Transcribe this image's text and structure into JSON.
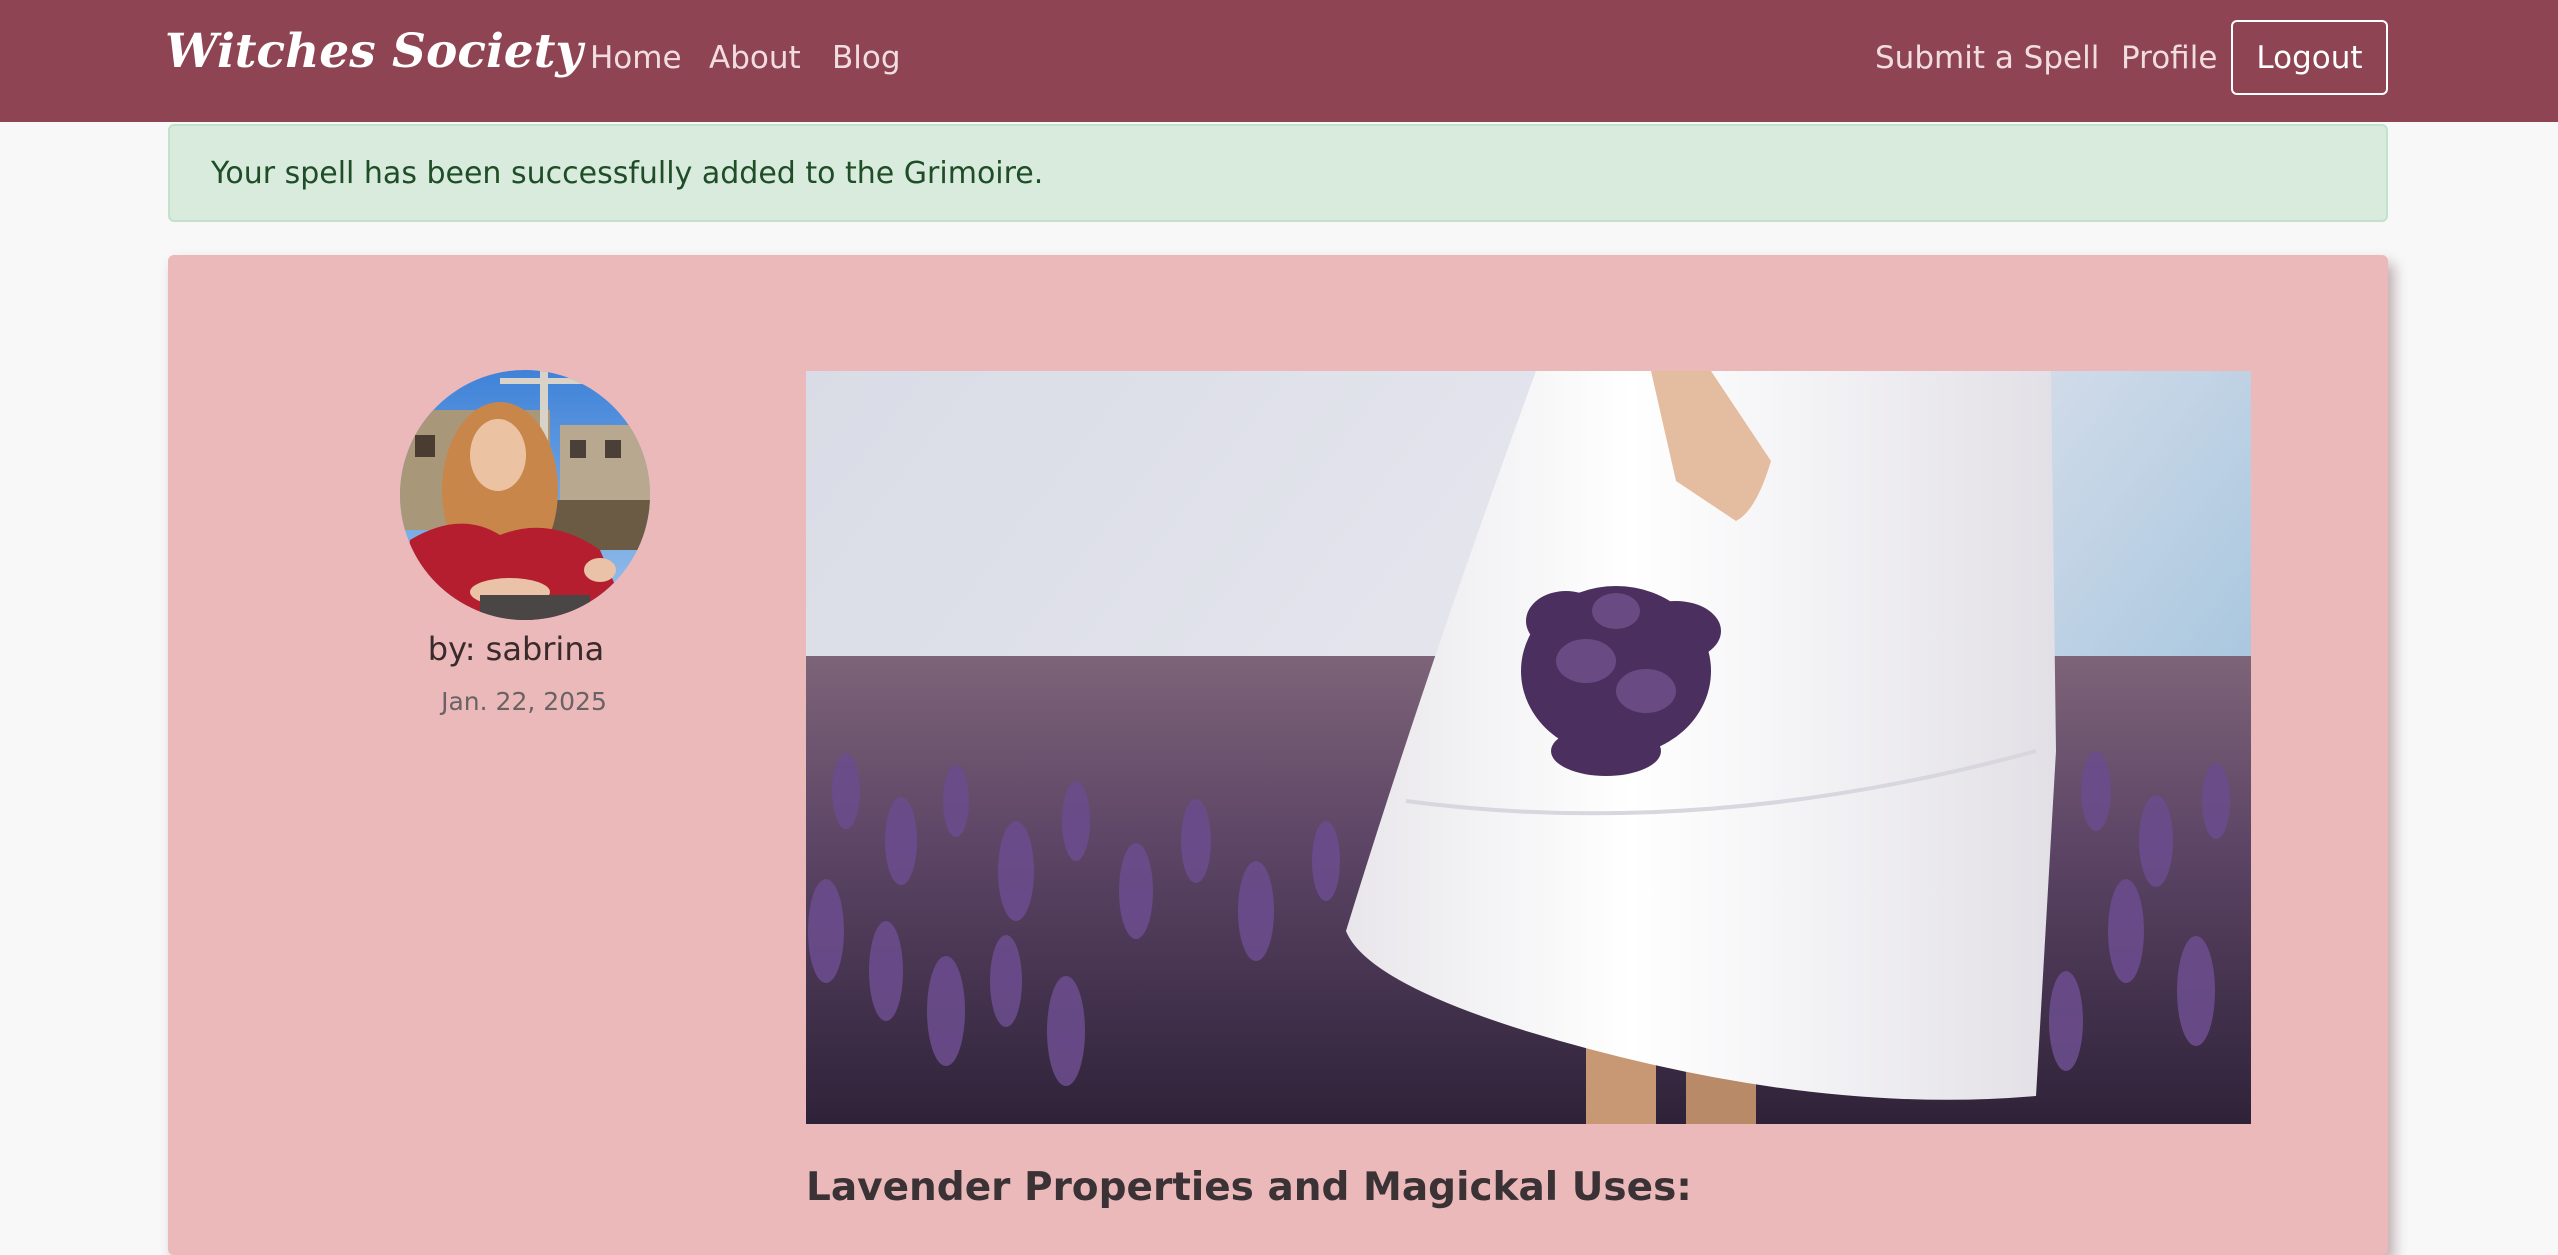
{
  "navbar": {
    "brand": "Witches Society",
    "links": {
      "home": "Home",
      "about": "About",
      "blog": "Blog",
      "submit": "Submit a Spell",
      "profile": "Profile"
    },
    "logout_label": "Logout"
  },
  "alert": {
    "message": "Your spell has been successfully added to the Grimoire."
  },
  "post": {
    "author": "by: sabrina",
    "date": "Jan. 22, 2025",
    "title": "Lavender Properties and Magickal Uses:"
  },
  "colors": {
    "navbar_bg": "#8e4452",
    "card_bg": "#ebb9ba",
    "alert_bg": "#d8ebdc",
    "alert_text": "#1f4d28"
  }
}
